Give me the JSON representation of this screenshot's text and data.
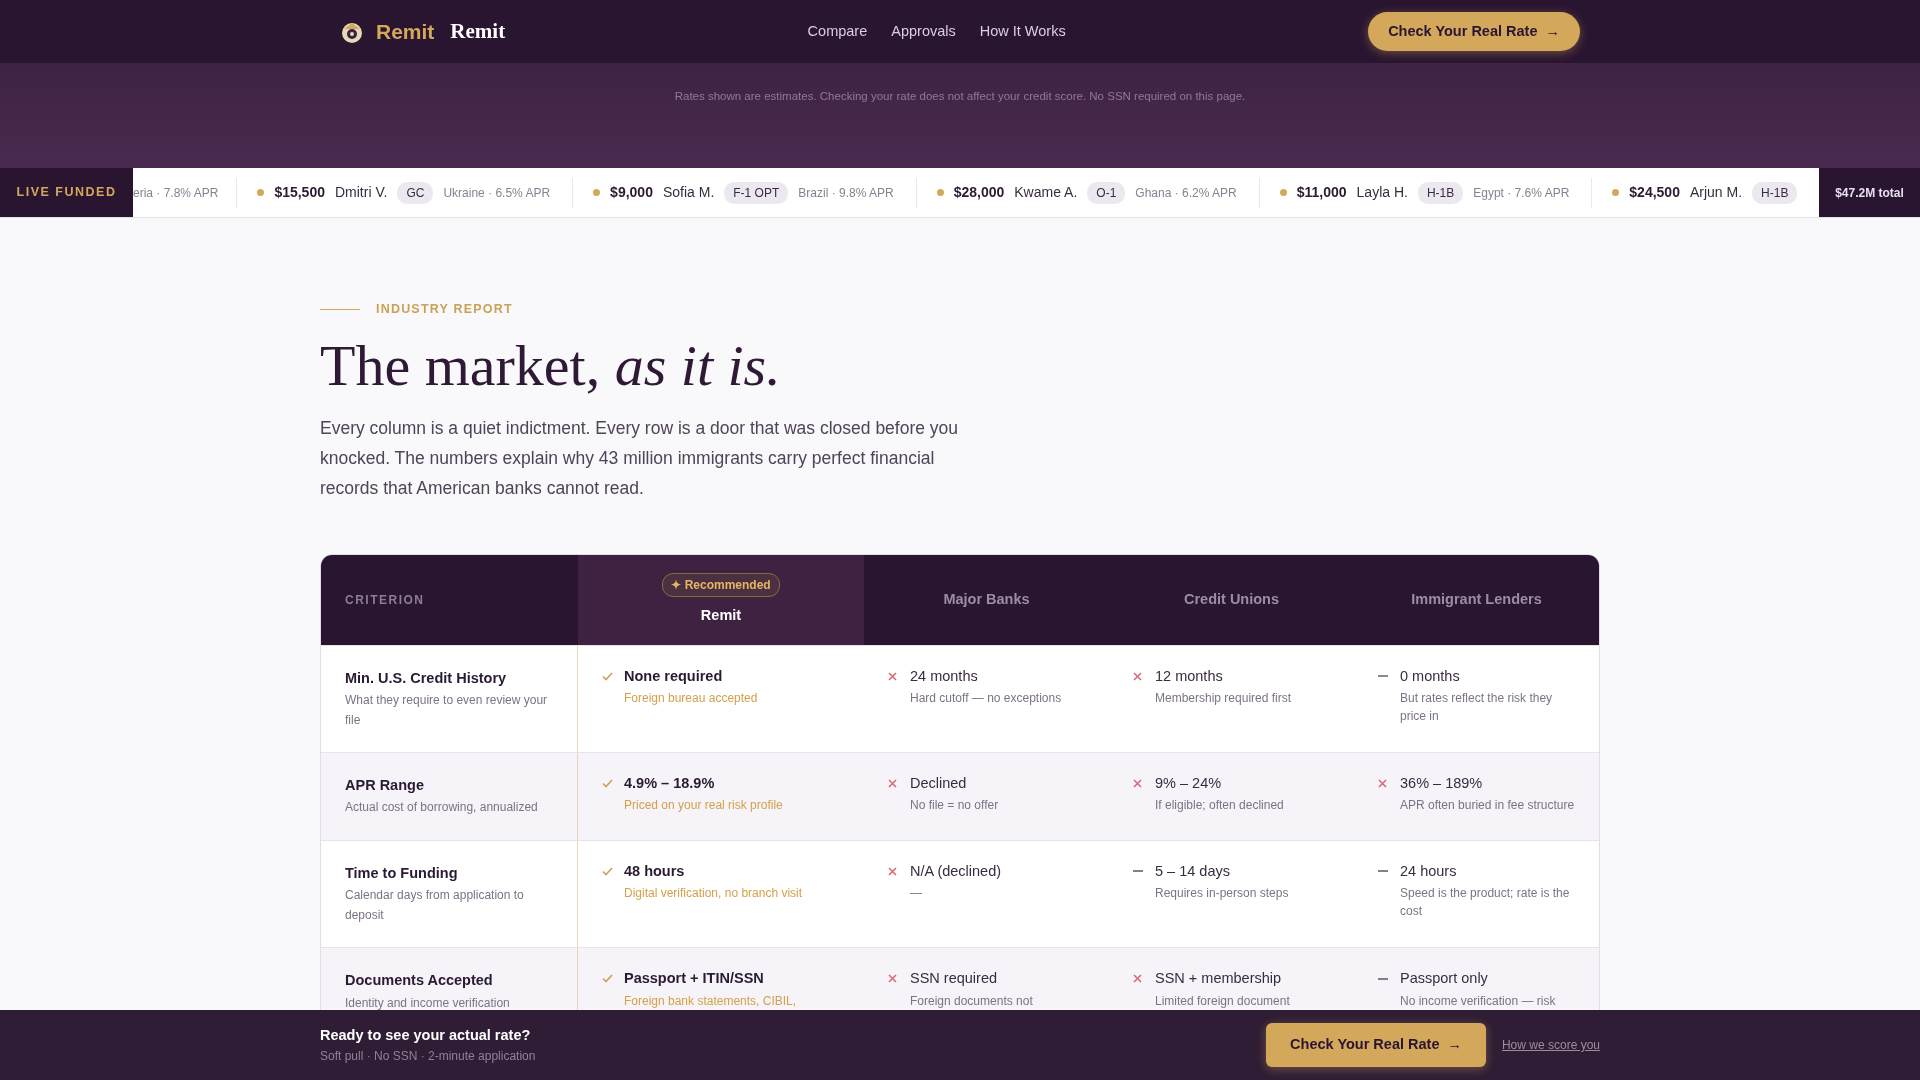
{
  "nav": {
    "brand_primary": "Remit",
    "brand_secondary": "Remit",
    "links": [
      "Compare",
      "Approvals",
      "How It Works"
    ],
    "cta": "Check Your Real Rate",
    "cta_icon": "→"
  },
  "disclaimer": "Rates shown are estimates. Checking your rate does not affect your credit score. No SSN required on this page.",
  "ticker": {
    "label": "LIVE FUNDED",
    "lead": "eria · 7.8% APR",
    "items": [
      {
        "amount": "$15,500",
        "name": "Dmitri V.",
        "visa": "GC",
        "detail": "Ukraine · 6.5% APR",
        "color": "#d4a85a"
      },
      {
        "amount": "$9,000",
        "name": "Sofia M.",
        "visa": "F-1 OPT",
        "detail": "Brazil · 9.8% APR",
        "color": "#d4a85a"
      },
      {
        "amount": "$28,000",
        "name": "Kwame A.",
        "visa": "O-1",
        "detail": "Ghana · 6.2% APR",
        "color": "#d4a85a"
      },
      {
        "amount": "$11,000",
        "name": "Layla H.",
        "visa": "H-1B",
        "detail": "Egypt · 7.6% APR",
        "color": "#d4a85a"
      },
      {
        "amount": "$24,500",
        "name": "Arjun M.",
        "visa": "H-1B",
        "color": "#d4a85a"
      }
    ],
    "total": "$47.2M total"
  },
  "report": {
    "eyebrow": "INDUSTRY REPORT",
    "title": "The market, *as it is.*",
    "intro": "Every column is a quiet indictment. Every row is a door that was closed before you knocked. The numbers explain why 43 million immigrants carry perfect financial records that American banks cannot read."
  },
  "table": {
    "criterion_heading": "CRITERION",
    "columns": [
      {
        "name": "Remit",
        "badge": "✦ Recommended",
        "highlighted": true
      },
      {
        "name": "Major Banks",
        "highlighted": false
      },
      {
        "name": "Credit Unions",
        "highlighted": false
      },
      {
        "name": "Immigrant Lenders",
        "highlighted": false
      }
    ],
    "rows": [
      {
        "criterion": "Min. U.S. Credit History",
        "description": "What they require to even review your file",
        "cells": [
          {
            "kind": "yes",
            "value": "None required",
            "note": "Foreign bureau accepted"
          },
          {
            "kind": "no",
            "value": "24 months",
            "note": "Hard cutoff — no exceptions"
          },
          {
            "kind": "no",
            "value": "12 months",
            "note": "Membership required first"
          },
          {
            "kind": "partial",
            "value": "0 months",
            "note": "But rates reflect the risk they price in"
          }
        ]
      },
      {
        "criterion": "APR Range",
        "description": "Actual cost of borrowing, annualized",
        "cells": [
          {
            "kind": "yes",
            "value": "4.9% – 18.9%",
            "note": "Priced on your real risk profile"
          },
          {
            "kind": "no",
            "value": "Declined",
            "note": "No file = no offer"
          },
          {
            "kind": "no",
            "value": "9% – 24%",
            "note": "If eligible; often declined"
          },
          {
            "kind": "no",
            "value": "36% – 189%",
            "note": "APR often buried in fee structure"
          }
        ]
      },
      {
        "criterion": "Time to Funding",
        "description": "Calendar days from application to deposit",
        "cells": [
          {
            "kind": "yes",
            "value": "48 hours",
            "note": "Digital verification, no branch visit"
          },
          {
            "kind": "no",
            "value": "N/A (declined)",
            "note": "—"
          },
          {
            "kind": "partial",
            "value": "5 – 14 days",
            "note": "Requires in-person steps"
          },
          {
            "kind": "partial",
            "value": "24 hours",
            "note": "Speed is the product; rate is the cost"
          }
        ]
      },
      {
        "criterion": "Documents Accepted",
        "description": "Identity and income verification",
        "cells": [
          {
            "kind": "yes",
            "value": "Passport + ITIN/SSN",
            "note": "Foreign bank statements, CIBIL,"
          },
          {
            "kind": "no",
            "value": "SSN required",
            "note": "Foreign documents not"
          },
          {
            "kind": "no",
            "value": "SSN + membership",
            "note": "Limited foreign document"
          },
          {
            "kind": "partial",
            "value": "Passport only",
            "note": "No income verification — risk"
          }
        ]
      }
    ]
  },
  "bottom_bar": {
    "title": "Ready to see your actual rate?",
    "subtitle": "Soft pull · No SSN · 2-minute application",
    "cta": "Check Your Real Rate",
    "cta_icon": "→",
    "link": "How we score you"
  }
}
